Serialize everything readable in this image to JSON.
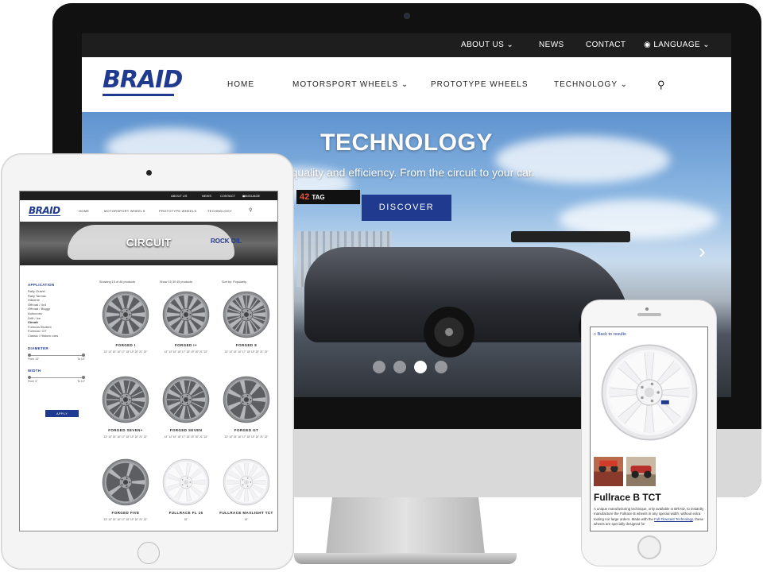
{
  "imac": {
    "topbar": {
      "about_us": "ABOUT US",
      "news": "NEWS",
      "contact": "CONTACT",
      "language": "LANGUAGE"
    },
    "logo": "BRAID",
    "nav": {
      "home": "HOME",
      "motorsport_wheels": "MOTORSPORT WHEELS",
      "prototype_wheels": "PROTOTYPE WHEELS",
      "technology": "TECHNOLOGY"
    },
    "hero": {
      "title": "TECHNOLOGY",
      "subtitle": "re quality and efficiency. From the circuit to your car.",
      "button": "DISCOVER",
      "sign": "42",
      "tag": "TAG",
      "active_slide": 3,
      "slide_count": 4
    }
  },
  "ipad": {
    "topbar": {
      "about_us": "ABOUT US",
      "news": "NEWS",
      "contact": "CONTACT",
      "language": "LANGUAGE"
    },
    "logo": "BRAID",
    "nav": {
      "home": "HOME",
      "motorsport_wheels": "MOTORSPORT WHEELS",
      "prototype_wheels": "PROTOTYPE WHEELS",
      "technology": "TECHNOLOGY"
    },
    "hero": {
      "title": "CIRCUIT",
      "sponsor": "ROCK OIL"
    },
    "sidebar": {
      "application_heading": "APPLICATION",
      "applications": [
        "Rally Gravel",
        "Rally Tarmac",
        "Hillclimb",
        "Offroad / 4x4",
        "Offroad / Buggy",
        "Autocross",
        "Drift / Ice",
        "Circuit",
        "Formula Student",
        "Formula / GT",
        "Classic / Historic cars"
      ],
      "active_application": "Circuit",
      "diameter_heading": "DIAMETER",
      "diameter_from": "From 13\"",
      "diameter_to": "To 19\"",
      "width_heading": "WIDTH",
      "width_from": "From 4\"",
      "width_to": "To 14\"",
      "apply": "APPLY"
    },
    "sortbar": {
      "showing": "Showing 15 of 46 products",
      "show": "Show 15 30 45 products",
      "sort_by": "Sort by: Popularity"
    },
    "products": [
      {
        "name": "FORGED I",
        "sizes": "13\" 14\" 15\" 16\" 17\" 18\" 19\" 20\" 21\" 22\""
      },
      {
        "name": "FORGED I+",
        "sizes": "13\" 14\" 15\" 16\" 17\" 18\" 19\" 20\" 21\" 22\""
      },
      {
        "name": "FORGED 8",
        "sizes": "13\" 14\" 15\" 16\" 17\" 18\" 19\" 20\" 21\" 22\""
      },
      {
        "name": "FORGED SEVEN+",
        "sizes": "13\" 14\" 15\" 16\" 17\" 18\" 19\" 20\" 21\" 22\""
      },
      {
        "name": "FORGED SEVEN",
        "sizes": "13\" 14\" 15\" 16\" 17\" 18\" 19\" 20\" 21\" 22\""
      },
      {
        "name": "FORGED GT",
        "sizes": "13\" 14\" 15\" 16\" 17\" 18\" 19\" 20\" 21\" 22\""
      },
      {
        "name": "FORGED FIVE",
        "sizes": "13\" 14\" 15\" 16\" 17\" 18\" 19\" 20\" 21\" 22\""
      },
      {
        "name": "FULLRACE FL 15",
        "sizes": "15\""
      },
      {
        "name": "FULLRACE MAXLIGHT TCT",
        "sizes": "15\""
      }
    ]
  },
  "iphone": {
    "back": "< Back to results",
    "title": "Fullrace B TCT",
    "desc_part1": "A unique manufacturing technique, only available in BRAID, to instantly manufacture the Fullrace B wheels in any special width, without extra tooling nor large orders. Made with the ",
    "desc_link": "Full Flowcast Technology",
    "desc_part2": ", these wheels are specially designed for"
  },
  "colors": {
    "brand_blue": "#1f3a8f",
    "topbar": "#1e1e1e"
  }
}
